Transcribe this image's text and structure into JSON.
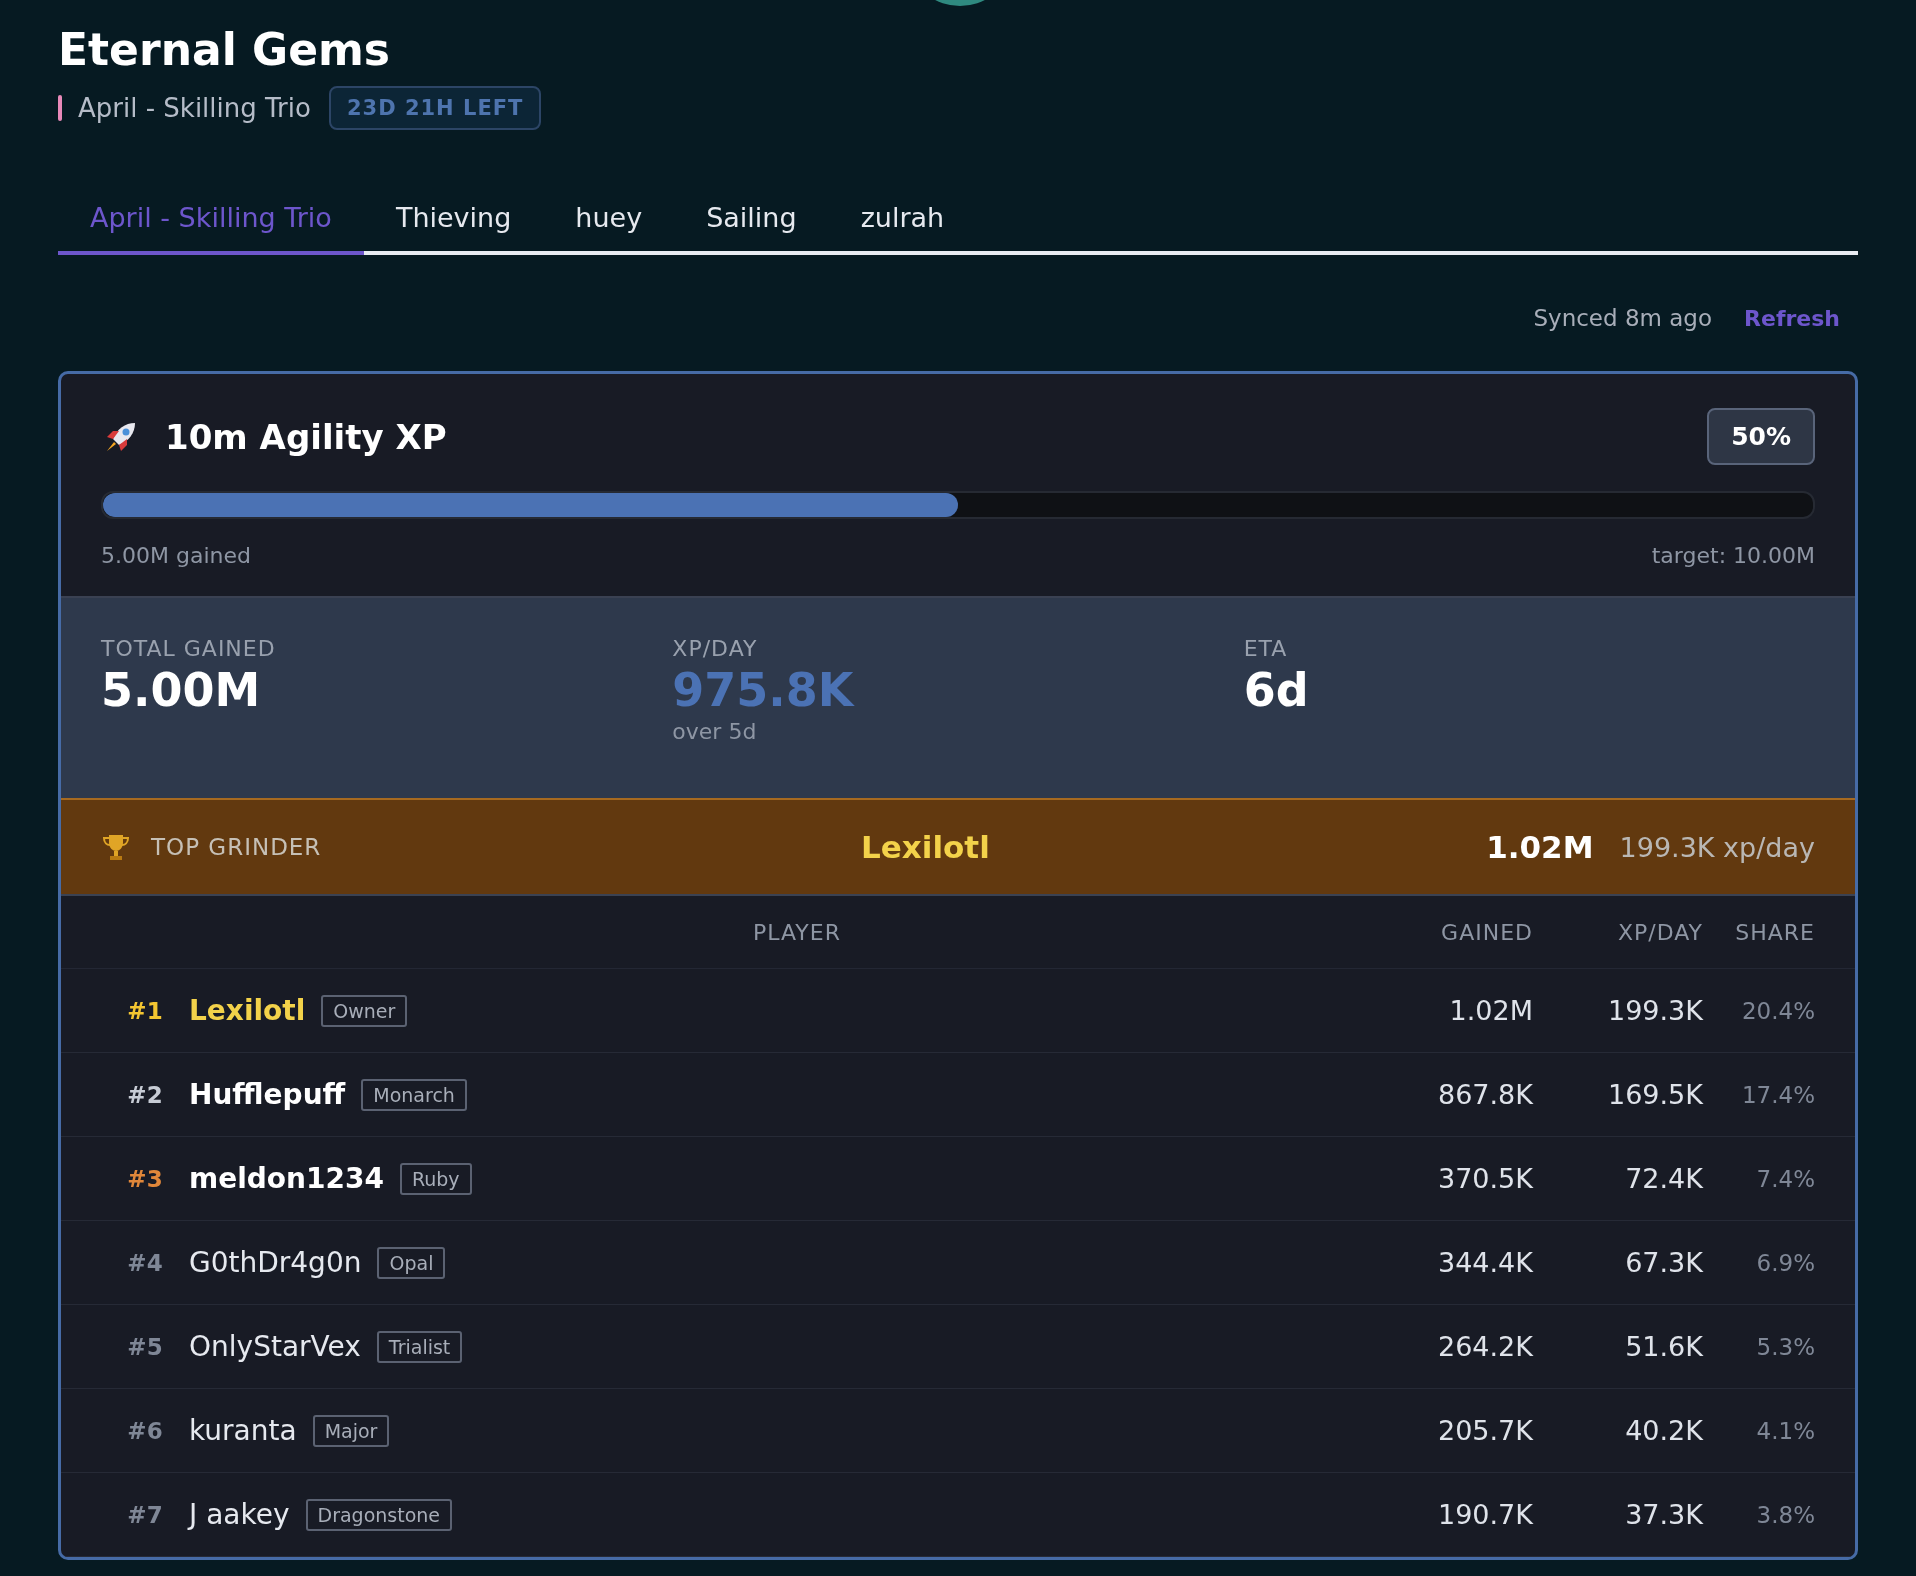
{
  "header": {
    "title": "Eternal Gems",
    "subtitle": "April - Skilling Trio",
    "time_left": "23D 21H LEFT"
  },
  "tabs": [
    {
      "label": "April - Skilling Trio",
      "selected": true
    },
    {
      "label": "Thieving",
      "selected": false
    },
    {
      "label": "huey",
      "selected": false
    },
    {
      "label": "Sailing",
      "selected": false
    },
    {
      "label": "zulrah",
      "selected": false
    }
  ],
  "sync": {
    "status": "Synced 8m ago",
    "action": "Refresh"
  },
  "goal": {
    "title": "10m Agility XP",
    "percent": "50%",
    "level": 0.5,
    "gained": "5.00M gained",
    "target": "target: 10.00M"
  },
  "stats": [
    {
      "label": "TOTAL GAINED",
      "value": "5.00M",
      "kind": "plain"
    },
    {
      "label": "XP/DAY",
      "value": "975.8K",
      "note": "over 5d",
      "kind": "accent"
    },
    {
      "label": "ETA",
      "value": "6d",
      "kind": "plain"
    }
  ],
  "top_grinder": {
    "label": "TOP GRINDER",
    "name": "Lexilotl",
    "gained": "1.02M",
    "rate": "199.3K xp/day"
  },
  "table": {
    "columns": [
      "PLAYER",
      "GAINED",
      "XP/DAY",
      "SHARE"
    ],
    "rows": [
      {
        "rank": "#1",
        "name": "Lexilotl",
        "role": "Owner",
        "gained": "1.02M",
        "rate": "199.3K",
        "share": "20.4%",
        "kind": "gold"
      },
      {
        "rank": "#2",
        "name": "Hufflepuff",
        "role": "Monarch",
        "gained": "867.8K",
        "rate": "169.5K",
        "share": "17.4%",
        "kind": "silver"
      },
      {
        "rank": "#3",
        "name": "meldon1234",
        "role": "Ruby",
        "gained": "370.5K",
        "rate": "72.4K",
        "share": "7.4%",
        "kind": "bronze"
      },
      {
        "rank": "#4",
        "name": "G0thDr4g0n",
        "role": "Opal",
        "gained": "344.4K",
        "rate": "67.3K",
        "share": "6.9%",
        "kind": "plain"
      },
      {
        "rank": "#5",
        "name": "OnlyStarVex",
        "role": "Trialist",
        "gained": "264.2K",
        "rate": "51.6K",
        "share": "5.3%",
        "kind": "plain"
      },
      {
        "rank": "#6",
        "name": "kuranta",
        "role": "Major",
        "gained": "205.7K",
        "rate": "40.2K",
        "share": "4.1%",
        "kind": "plain"
      },
      {
        "rank": "#7",
        "name": "J aakey",
        "role": "Dragonstone",
        "gained": "190.7K",
        "rate": "37.3K",
        "share": "3.8%",
        "kind": "plain"
      }
    ]
  }
}
